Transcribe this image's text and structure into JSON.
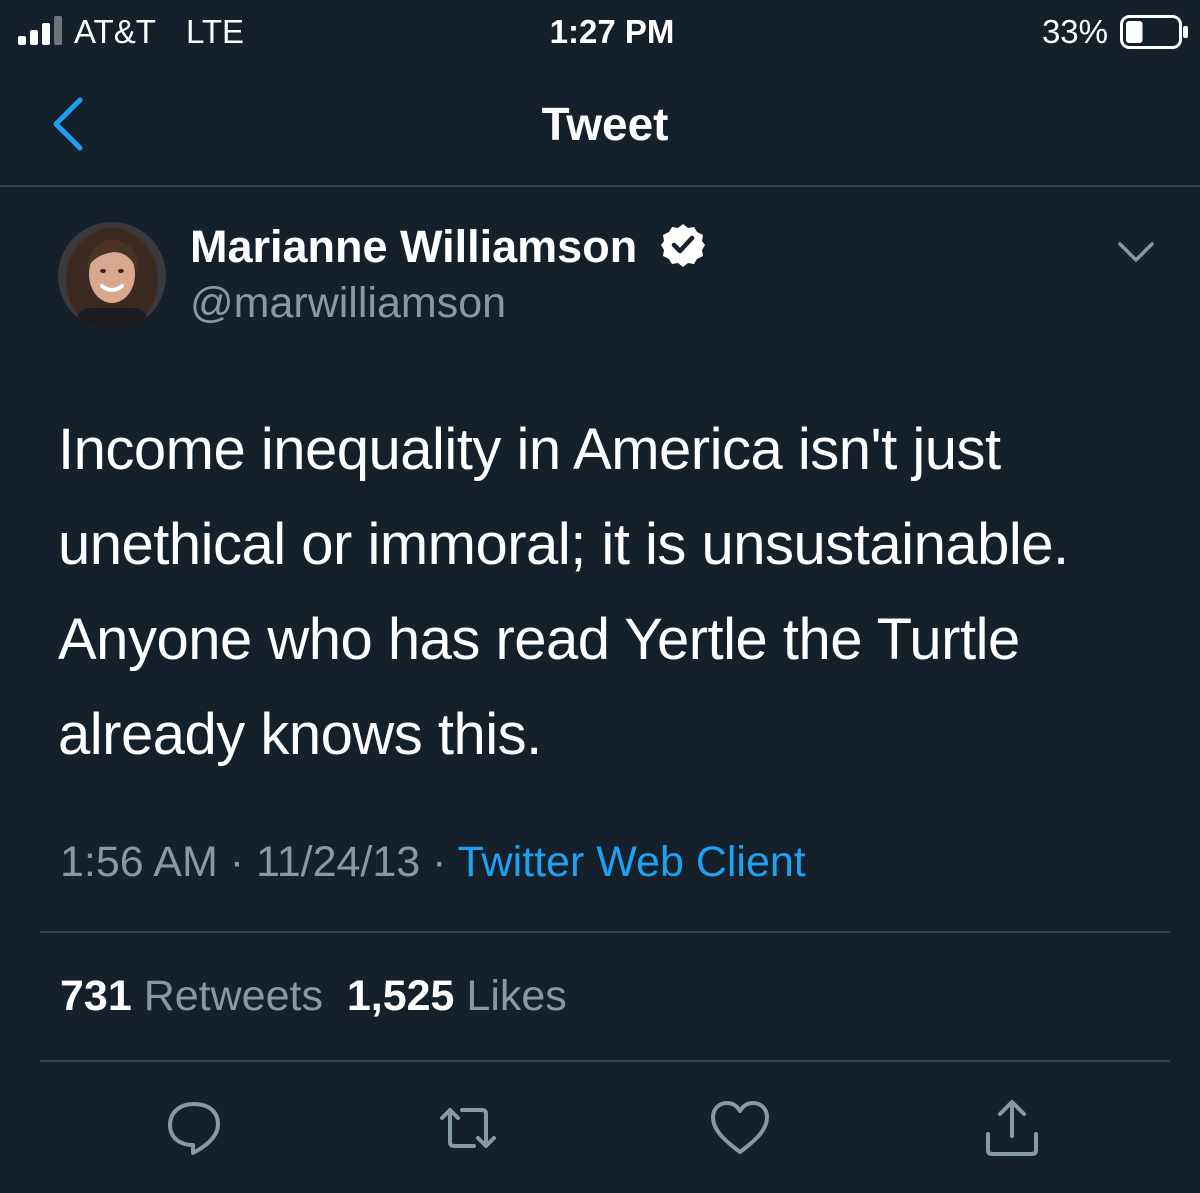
{
  "status_bar": {
    "carrier": "AT&T",
    "network": "LTE",
    "time": "1:27 PM",
    "battery_percent": "33%",
    "battery_level": 0.33
  },
  "header": {
    "title": "Tweet",
    "back_icon": "chevron-left-icon"
  },
  "tweet": {
    "author_name": "Marianne Williamson",
    "author_handle": "@marwilliamson",
    "verified": true,
    "text": "Income inequality in America isn't just unethical or immoral; it is unsustainable. Anyone who has read Yertle the Turtle already knows this.",
    "time": "1:56 AM",
    "date": "11/24/13",
    "separator": "·",
    "source": "Twitter Web Client",
    "retweet_count": "731",
    "retweet_label": "Retweets",
    "like_count": "1,525",
    "like_label": "Likes"
  },
  "actions": [
    {
      "name": "reply",
      "icon": "reply-icon"
    },
    {
      "name": "retweet",
      "icon": "retweet-icon"
    },
    {
      "name": "like",
      "icon": "heart-icon"
    },
    {
      "name": "share",
      "icon": "share-icon"
    }
  ],
  "colors": {
    "background": "#15202b",
    "accent": "#1da1f2",
    "secondary_text": "#8899a6",
    "divider": "#38444d"
  }
}
